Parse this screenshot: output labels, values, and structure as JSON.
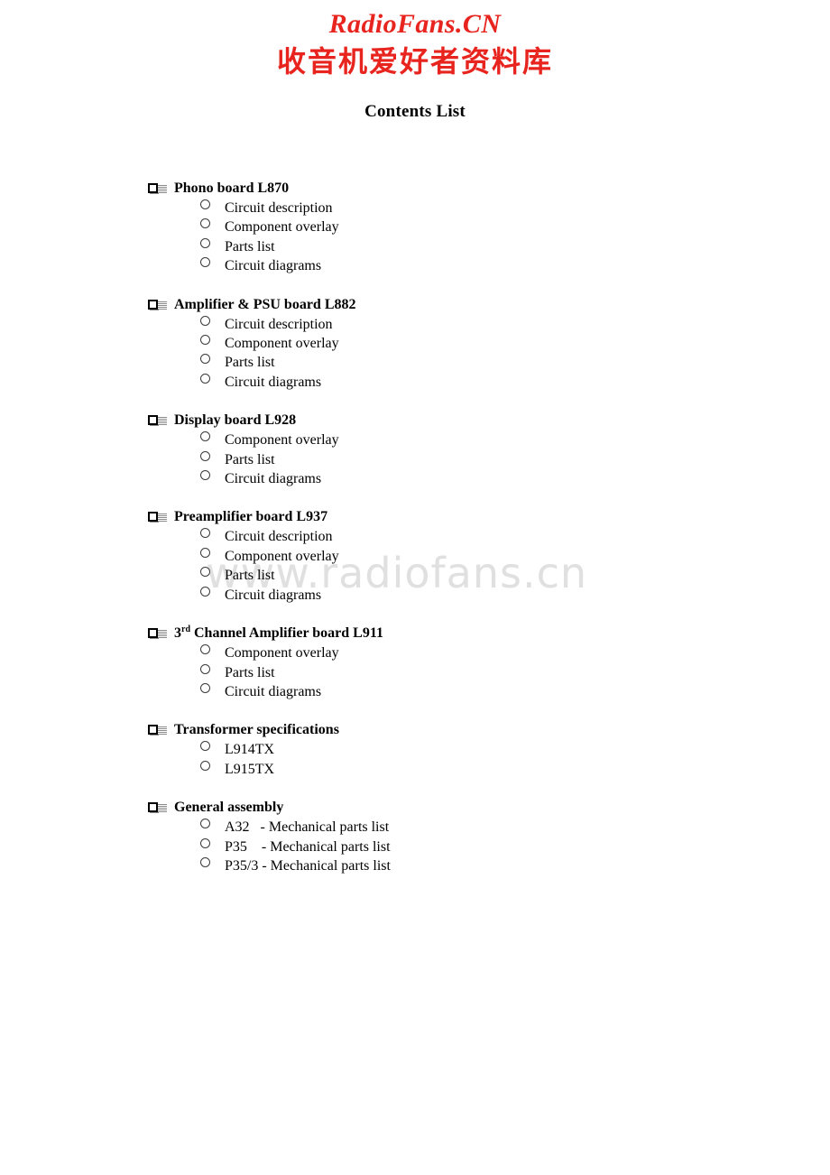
{
  "watermark": {
    "header_latin": "RadioFans.CN",
    "header_chinese": "收音机爱好者资料库",
    "header_color": "#e8241f",
    "body_text": "www.radiofans.cn",
    "body_color": "#e0e0e0"
  },
  "document": {
    "title": "Contents List",
    "groups": [
      {
        "heading": "Phono board L870",
        "items": [
          "Circuit description",
          "Component overlay",
          "Parts list",
          "Circuit diagrams"
        ]
      },
      {
        "heading": "Amplifier & PSU board L882",
        "items": [
          "Circuit description",
          "Component overlay",
          "Parts list",
          "Circuit diagrams"
        ]
      },
      {
        "heading": "Display board L928",
        "items": [
          "Component overlay",
          "Parts list",
          "Circuit diagrams"
        ]
      },
      {
        "heading": "Preamplifier board L937",
        "items": [
          "Circuit description",
          "Component overlay",
          "Parts list",
          "Circuit diagrams"
        ]
      },
      {
        "heading_prefix": "3",
        "heading_superscript": "rd",
        "heading_suffix": " Channel Amplifier board L911",
        "heading": "3rd Channel Amplifier board L911",
        "items": [
          "Component overlay",
          "Parts list",
          "Circuit diagrams"
        ]
      },
      {
        "heading": "Transformer specifications",
        "items": [
          "L914TX",
          "L915TX"
        ]
      },
      {
        "heading": "General assembly",
        "items": [
          "A32   - Mechanical parts list",
          "P35    - Mechanical parts list",
          "P35/3 - Mechanical parts list"
        ]
      }
    ]
  }
}
